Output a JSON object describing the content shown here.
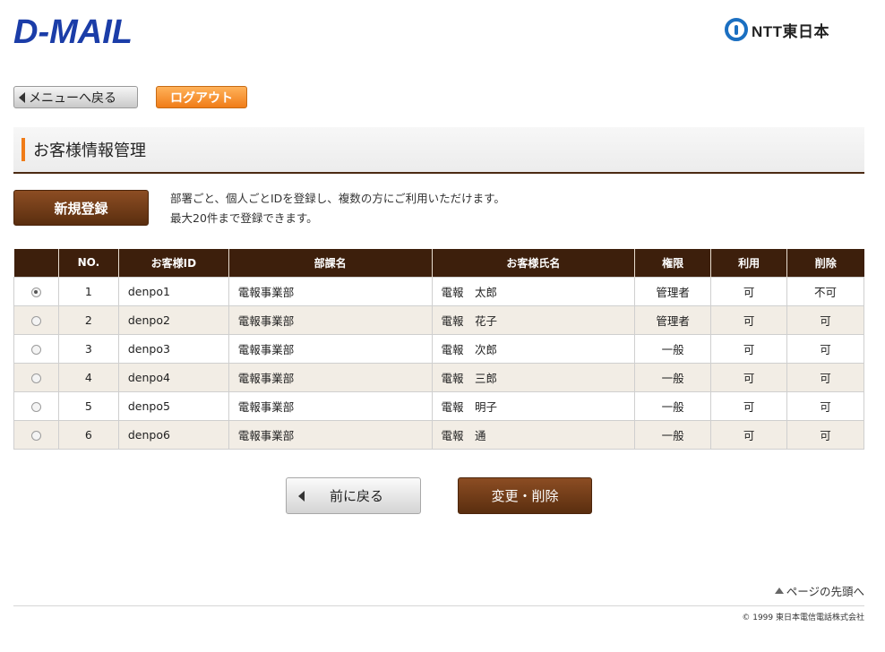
{
  "header": {
    "logo_text": "D-MAIL",
    "ntt_text": "NTT東日本"
  },
  "top_buttons": {
    "back_to_menu": "メニューへ戻る",
    "logout": "ログアウト"
  },
  "section": {
    "title": "お客様情報管理"
  },
  "register": {
    "button_label": "新規登録",
    "desc_line1": "部署ごと、個人ごとIDを登録し、複数の方にご利用いただけます。",
    "desc_line2": "最大20件まで登録できます。"
  },
  "table": {
    "headers": [
      "",
      "NO.",
      "お客様ID",
      "部課名",
      "お客様氏名",
      "権限",
      "利用",
      "削除"
    ],
    "rows": [
      {
        "selected": true,
        "no": "1",
        "id": "denpo1",
        "dept": "電報事業部",
        "name": "電報　太郎",
        "role": "管理者",
        "use": "可",
        "delete": "不可"
      },
      {
        "selected": false,
        "no": "2",
        "id": "denpo2",
        "dept": "電報事業部",
        "name": "電報　花子",
        "role": "管理者",
        "use": "可",
        "delete": "可"
      },
      {
        "selected": false,
        "no": "3",
        "id": "denpo3",
        "dept": "電報事業部",
        "name": "電報　次郎",
        "role": "一般",
        "use": "可",
        "delete": "可"
      },
      {
        "selected": false,
        "no": "4",
        "id": "denpo4",
        "dept": "電報事業部",
        "name": "電報　三郎",
        "role": "一般",
        "use": "可",
        "delete": "可"
      },
      {
        "selected": false,
        "no": "5",
        "id": "denpo5",
        "dept": "電報事業部",
        "name": "電報　明子",
        "role": "一般",
        "use": "可",
        "delete": "可"
      },
      {
        "selected": false,
        "no": "6",
        "id": "denpo6",
        "dept": "電報事業部",
        "name": "電報　通",
        "role": "一般",
        "use": "可",
        "delete": "可"
      }
    ]
  },
  "bottom_buttons": {
    "prev": "前に戻る",
    "change_delete": "変更・削除"
  },
  "footer": {
    "page_top": "ページの先頭へ",
    "copyright": "© 1999 東日本電信電話株式会社"
  },
  "colors": {
    "brand_blue": "#1b3da8",
    "accent_orange": "#f07c18",
    "dark_brown": "#3d1f0c",
    "ntt_blue": "#1b6fc1"
  }
}
